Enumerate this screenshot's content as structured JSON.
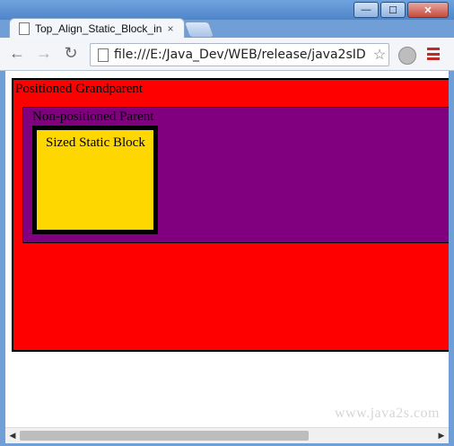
{
  "browser": {
    "tab_title": "Top_Align_Static_Block_in",
    "tab_close": "×",
    "address": "file:///E:/Java_Dev/WEB/release/java2sID",
    "window_buttons": {
      "minimize": "—",
      "maximize": "☐",
      "close": "✕"
    },
    "nav": {
      "back": "←",
      "forward": "→",
      "reload": "↻",
      "star": "☆"
    }
  },
  "page": {
    "grandparent_label": "Positioned Grandparent",
    "parent_label": "Non-positioned Parent",
    "static_block_label": "Sized Static Block",
    "watermark": "www.java2s.com",
    "colors": {
      "grandparent": "#ff0000",
      "parent": "#800080",
      "static_block": "#ffd700"
    }
  },
  "scrollbar": {
    "left": "◀",
    "right": "▶"
  }
}
